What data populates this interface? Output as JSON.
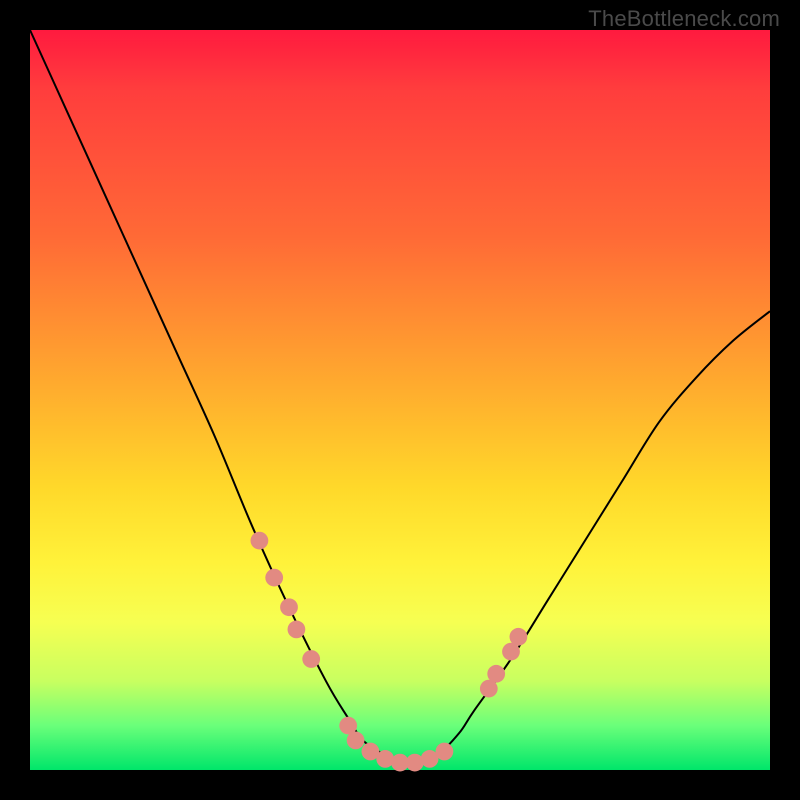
{
  "watermark": "TheBottleneck.com",
  "chart_data": {
    "type": "line",
    "title": "",
    "xlabel": "",
    "ylabel": "",
    "xlim": [
      0,
      100
    ],
    "ylim": [
      0,
      100
    ],
    "grid": false,
    "legend": false,
    "background_gradient": {
      "stops": [
        {
          "pos": 0,
          "color": "#ff1a3f"
        },
        {
          "pos": 28,
          "color": "#ff6a36"
        },
        {
          "pos": 48,
          "color": "#ffab2e"
        },
        {
          "pos": 72,
          "color": "#fff23a"
        },
        {
          "pos": 88,
          "color": "#c8ff60"
        },
        {
          "pos": 100,
          "color": "#00e66a"
        }
      ]
    },
    "series": [
      {
        "name": "bottleneck-curve",
        "color": "#000000",
        "x": [
          0,
          5,
          10,
          15,
          20,
          25,
          30,
          35,
          40,
          43,
          45,
          48,
          50,
          52,
          55,
          58,
          60,
          65,
          70,
          75,
          80,
          85,
          90,
          95,
          100
        ],
        "y": [
          100,
          89,
          78,
          67,
          56,
          45,
          33,
          22,
          12,
          7,
          4,
          2,
          1,
          1,
          2,
          5,
          8,
          15,
          23,
          31,
          39,
          47,
          53,
          58,
          62
        ]
      }
    ],
    "highlight_points": {
      "name": "selected-range-markers",
      "color": "#e28a82",
      "radius_pct": 1.2,
      "points": [
        {
          "x": 31,
          "y": 31
        },
        {
          "x": 33,
          "y": 26
        },
        {
          "x": 35,
          "y": 22
        },
        {
          "x": 36,
          "y": 19
        },
        {
          "x": 38,
          "y": 15
        },
        {
          "x": 43,
          "y": 6
        },
        {
          "x": 44,
          "y": 4
        },
        {
          "x": 46,
          "y": 2.5
        },
        {
          "x": 48,
          "y": 1.5
        },
        {
          "x": 50,
          "y": 1
        },
        {
          "x": 52,
          "y": 1
        },
        {
          "x": 54,
          "y": 1.5
        },
        {
          "x": 56,
          "y": 2.5
        },
        {
          "x": 62,
          "y": 11
        },
        {
          "x": 63,
          "y": 13
        },
        {
          "x": 65,
          "y": 16
        },
        {
          "x": 66,
          "y": 18
        }
      ]
    }
  }
}
